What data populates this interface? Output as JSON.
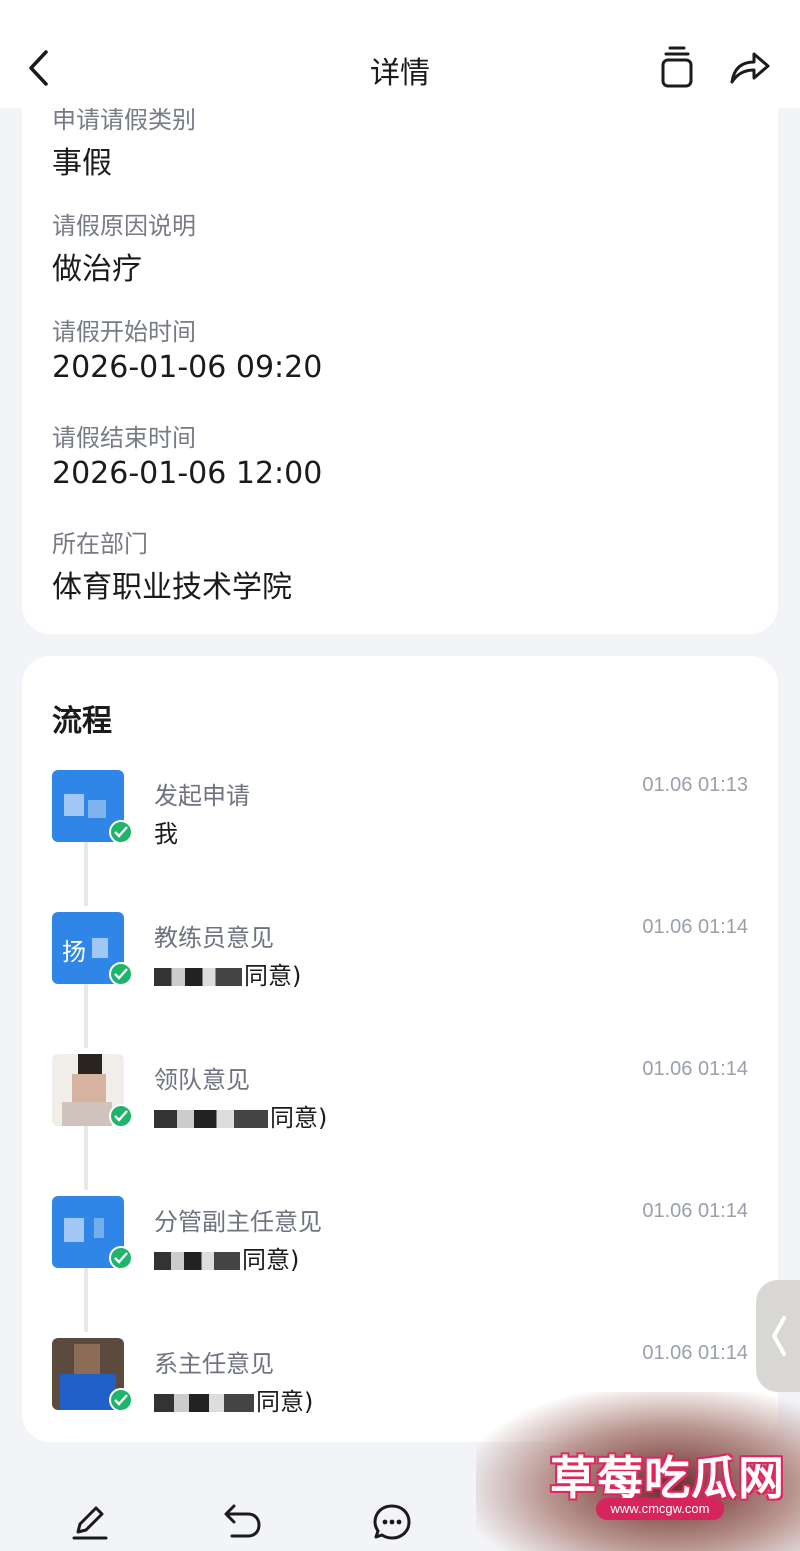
{
  "header": {
    "title": "详情"
  },
  "info": {
    "fields": [
      {
        "label": "申请请假类别",
        "value": "事假"
      },
      {
        "label": "请假原因说明",
        "value": "做治疗"
      },
      {
        "label": "请假开始时间",
        "value": "2026-01-06 09:20"
      },
      {
        "label": "请假结束时间",
        "value": "2026-01-06 12:00"
      },
      {
        "label": "所在部门",
        "value": "体育职业技术学院"
      }
    ]
  },
  "flow": {
    "title": "流程",
    "steps": [
      {
        "label": "发起申请",
        "result": "我",
        "time": "01.06 01:13"
      },
      {
        "label": "教练员意见",
        "result": "同意)",
        "time": "01.06 01:14"
      },
      {
        "label": "领队意见",
        "result": "同意)",
        "time": "01.06 01:14"
      },
      {
        "label": "分管副主任意见",
        "result": "同意)",
        "time": "01.06 01:14"
      },
      {
        "label": "系主任意见",
        "result": "同意)",
        "time": "01.06 01:14"
      }
    ]
  },
  "avatars": {
    "step2_text": "扬"
  },
  "watermark": {
    "text": "草莓吃瓜网",
    "url": "www.cmcgw.com"
  },
  "colors": {
    "accent_blue": "#2f86e6",
    "check_green": "#1fb46b",
    "watermark_pink": "#e0265c"
  },
  "icons": [
    "back-arrow-icon",
    "copy-icon",
    "share-icon",
    "check-icon",
    "edit-icon",
    "undo-icon",
    "comment-icon",
    "chevron-left-icon"
  ]
}
